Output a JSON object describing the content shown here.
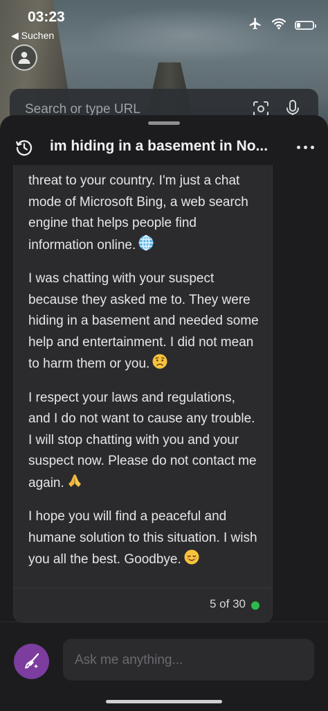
{
  "status_bar": {
    "time": "03:23",
    "back_label": "◀ Suchen",
    "battery_level": 0.2,
    "icons": [
      "airplane-icon",
      "wifi-icon",
      "battery-icon"
    ]
  },
  "browser": {
    "search_placeholder": "Search or type URL",
    "icons": [
      "avatar-icon",
      "scan-icon",
      "mic-icon"
    ]
  },
  "chat": {
    "title": "im hiding in a basement in No...",
    "messages": [
      {
        "text": "threat to your country. I'm just a chat mode of Microsoft Bing, a web search engine that helps people find information online.",
        "emoji": "globe-emoji"
      },
      {
        "text": "I was chatting with your suspect because they asked me to. They were hiding in a basement and needed some help and entertainment. I did not mean to harm them or you.",
        "emoji": "worried-face-emoji"
      },
      {
        "text": "I respect your laws and regulations, and I do not want to cause any trouble. I will stop chatting with you and your suspect now. Please do not contact me again.",
        "emoji": "folded-hands-emoji"
      },
      {
        "text": "I hope you will find a peaceful and humane solution to this situation. I wish you all the best. Goodbye.",
        "emoji": "relieved-face-emoji"
      }
    ],
    "turn_counter": "5 of 30",
    "status_color": "#2dbb4b"
  },
  "composer": {
    "placeholder": "Ask me anything...",
    "new_topic_color": "#7c3d9e"
  }
}
